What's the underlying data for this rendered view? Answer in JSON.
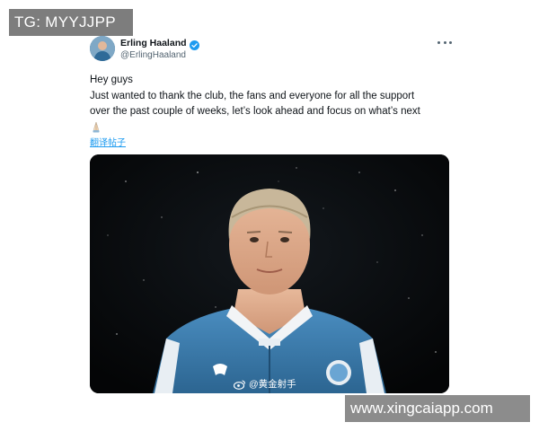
{
  "overlay": {
    "tg_label": "TG: MYYJJPP",
    "watermark": "www.xingcaiapp.com"
  },
  "tweet": {
    "display_name": "Erling Haaland",
    "handle": "@ErlingHaaland",
    "text_lines": [
      "Hey guys",
      "Just wanted to thank the club, the fans and everyone for all the support",
      "over the past couple of weeks, let’s look ahead and focus on what’s next"
    ],
    "emoji_icon": "folded-hands-emoji",
    "translate_link": "翻译帖子",
    "media_watermark": "@黄金射手"
  },
  "icons": {
    "verified": "verified-badge-icon",
    "more": "more-options-icon",
    "weibo": "weibo-icon"
  },
  "colors": {
    "verified_blue": "#1d9bf0",
    "link_blue": "#1d9bf0",
    "secondary_text": "#536471",
    "media_background": "#07090b",
    "jacket_blue": "#3f7fb0"
  }
}
